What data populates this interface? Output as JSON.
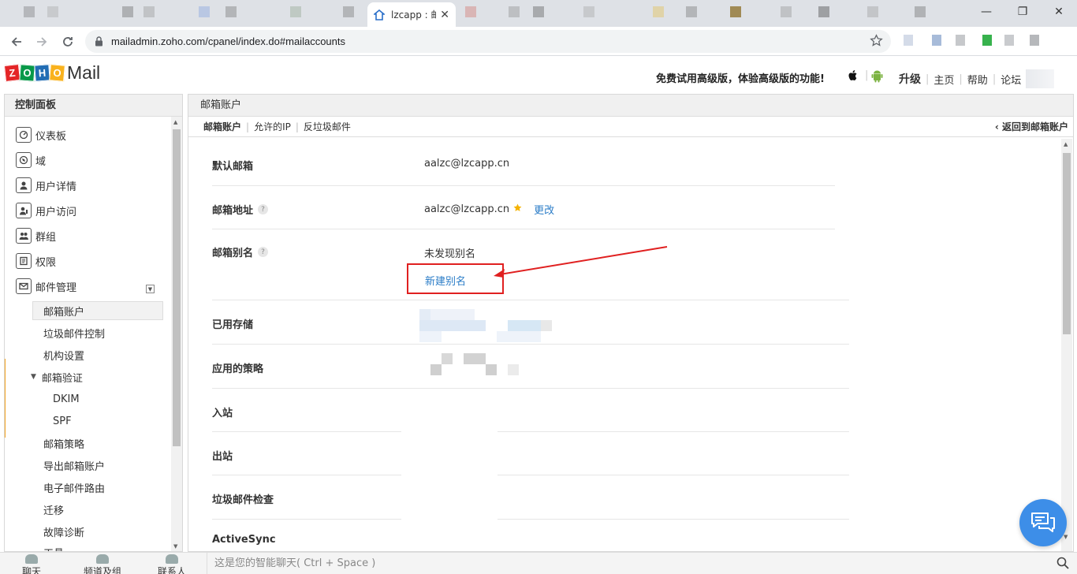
{
  "browser": {
    "tab_title": "lzcapp : 邮",
    "url": "mailadmin.zoho.com/cpanel/index.do#mailaccounts"
  },
  "header": {
    "logo_letters": [
      "Z",
      "O",
      "H",
      "O"
    ],
    "logo_colors": [
      "#e42527",
      "#089949",
      "#226db4",
      "#f9b21d"
    ],
    "logo_product": "Mail",
    "promo": "免费试用高级版，体验高级版的功能!",
    "links": {
      "upgrade": "升级",
      "home": "主页",
      "help": "帮助",
      "forum": "论坛"
    }
  },
  "sidebar": {
    "title": "控制面板",
    "items": [
      {
        "label": "仪表板",
        "icon": "dashboard-icon"
      },
      {
        "label": "域",
        "icon": "domain-icon"
      },
      {
        "label": "用户详情",
        "icon": "user-icon"
      },
      {
        "label": "用户访问",
        "icon": "user-access-icon"
      },
      {
        "label": "群组",
        "icon": "group-icon"
      },
      {
        "label": "权限",
        "icon": "privilege-icon"
      },
      {
        "label": "邮件管理",
        "icon": "mail-icon"
      }
    ],
    "sub_items": [
      "邮箱账户",
      "垃圾邮件控制",
      "机构设置",
      "邮箱验证"
    ],
    "sub_sub_items": [
      "DKIM",
      "SPF"
    ],
    "more_items": [
      "邮箱策略",
      "导出邮箱账户",
      "电子邮件路由",
      "迁移",
      "故障诊断",
      "工具"
    ]
  },
  "main": {
    "title": "邮箱账户",
    "tabs": [
      "邮箱账户",
      "允许的IP",
      "反垃圾邮件"
    ],
    "back_link": "返回到邮箱账户",
    "rows": {
      "default_mailbox": {
        "label": "默认邮箱",
        "value": "aalzc@lzcapp.cn"
      },
      "mail_address": {
        "label": "邮箱地址",
        "value": "aalzc@lzcapp.cn",
        "action": "更改"
      },
      "alias": {
        "label": "邮箱别名",
        "value": "未发现别名",
        "action": "新建别名"
      },
      "storage": {
        "label": "已用存储"
      },
      "policy": {
        "label": "应用的策略"
      },
      "incoming": {
        "label": "入站"
      },
      "outgoing": {
        "label": "出站"
      },
      "spam_check": {
        "label": "垃圾邮件检查"
      },
      "activesync": {
        "label": "ActiveSync"
      }
    },
    "help_mark": "?"
  },
  "footer": {
    "chat": "聊天",
    "channels": "频道及组",
    "contacts": "联系人",
    "chat_placeholder": "这是您的智能聊天( Ctrl + Space )"
  },
  "colors": {
    "link": "#2a7cc7",
    "active_accent": "#f5a623",
    "annotation": "#e02020",
    "fab": "#3d8ee8"
  }
}
